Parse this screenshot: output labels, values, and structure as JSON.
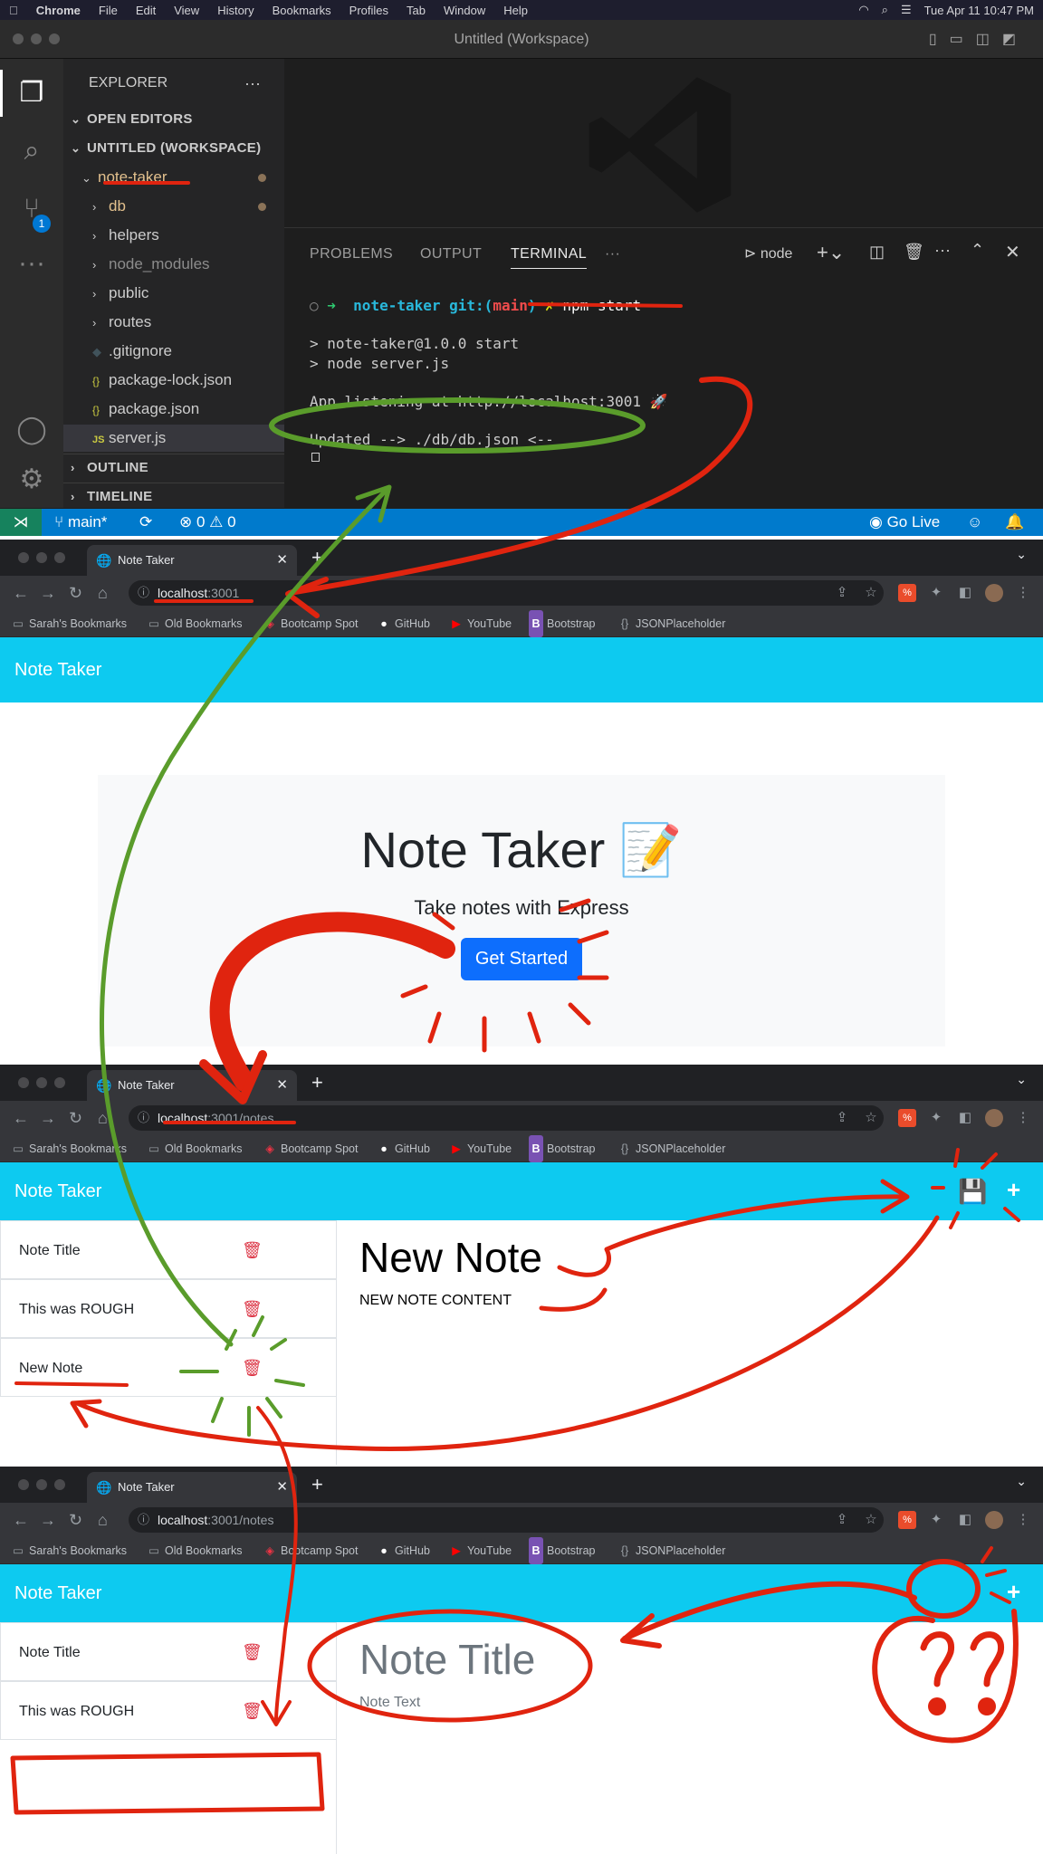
{
  "menubar": {
    "items": [
      "Chrome",
      "File",
      "Edit",
      "View",
      "History",
      "Bookmarks",
      "Profiles",
      "Tab",
      "Window",
      "Help"
    ],
    "clock": "Tue Apr 11  10:47 PM"
  },
  "vscode": {
    "title": "Untitled (Workspace)",
    "scm_badge": "1",
    "explorer": {
      "header": "EXPLORER",
      "open_editors": "OPEN EDITORS",
      "workspace": "UNTITLED (WORKSPACE)",
      "project": "note-taker",
      "items": [
        {
          "label": "db",
          "icon": "chevron-right"
        },
        {
          "label": "helpers",
          "icon": "chevron-right"
        },
        {
          "label": "node_modules",
          "icon": "chevron-right"
        },
        {
          "label": "public",
          "icon": "chevron-right"
        },
        {
          "label": "routes",
          "icon": "chevron-right"
        },
        {
          "label": ".gitignore",
          "icon": "git-icon"
        },
        {
          "label": "package-lock.json",
          "icon": "json-icon"
        },
        {
          "label": "package.json",
          "icon": "json-icon"
        },
        {
          "label": "server.js",
          "icon": "js-icon"
        }
      ],
      "outline": "OUTLINE",
      "timeline": "TIMELINE"
    },
    "panel": {
      "tabs": [
        "PROBLEMS",
        "OUTPUT",
        "TERMINAL"
      ],
      "active_tab": "TERMINAL",
      "shell": "node",
      "prompt_dir": "note-taker",
      "prompt_git": "git:(",
      "prompt_branch": "main",
      "prompt_git_end": ")",
      "prompt_mark": "✗",
      "command": "npm start",
      "lines": [
        "> note-taker@1.0.0 start",
        "> node server.js",
        "App listening at http://localhost:3001 🚀",
        "Updated --> ./db/db.json <--"
      ]
    },
    "status": {
      "branch": "main*",
      "errors": "0",
      "warnings": "0",
      "go_live": "Go Live"
    }
  },
  "bookmarks": [
    "Sarah's Bookmarks",
    "Old Bookmarks",
    "Bootcamp Spot",
    "GitHub",
    "YouTube",
    "Bootstrap",
    "JSONPlaceholder"
  ],
  "browser1": {
    "tab_title": "Note Taker",
    "url_host": "localhost",
    "url_rest": ":3001",
    "brand": "Note Taker",
    "heading": "Note Taker 📝",
    "lead": "Take notes with Express",
    "button": "Get Started"
  },
  "browser2": {
    "tab_title": "Note Taker",
    "url_host": "localhost",
    "url_rest": ":3001/notes",
    "brand": "Note Taker",
    "notes": [
      "Note Title",
      "This was ROUGH",
      "New Note"
    ],
    "note_title": "New Note",
    "note_text": "NEW NOTE CONTENT"
  },
  "browser3": {
    "tab_title": "Note Taker",
    "url_host": "localhost",
    "url_rest": ":3001/notes",
    "brand": "Note Taker",
    "notes": [
      "Note Title",
      "This was ROUGH"
    ],
    "title_placeholder": "Note Title",
    "text_placeholder": "Note Text"
  },
  "colors": {
    "navbar": "#0dcaf0",
    "primary": "#0d6efd",
    "danger": "#dc3545",
    "vscode_status": "#007acc",
    "annotation_red": "#e0240f",
    "annotation_green": "#5a9c2b"
  }
}
